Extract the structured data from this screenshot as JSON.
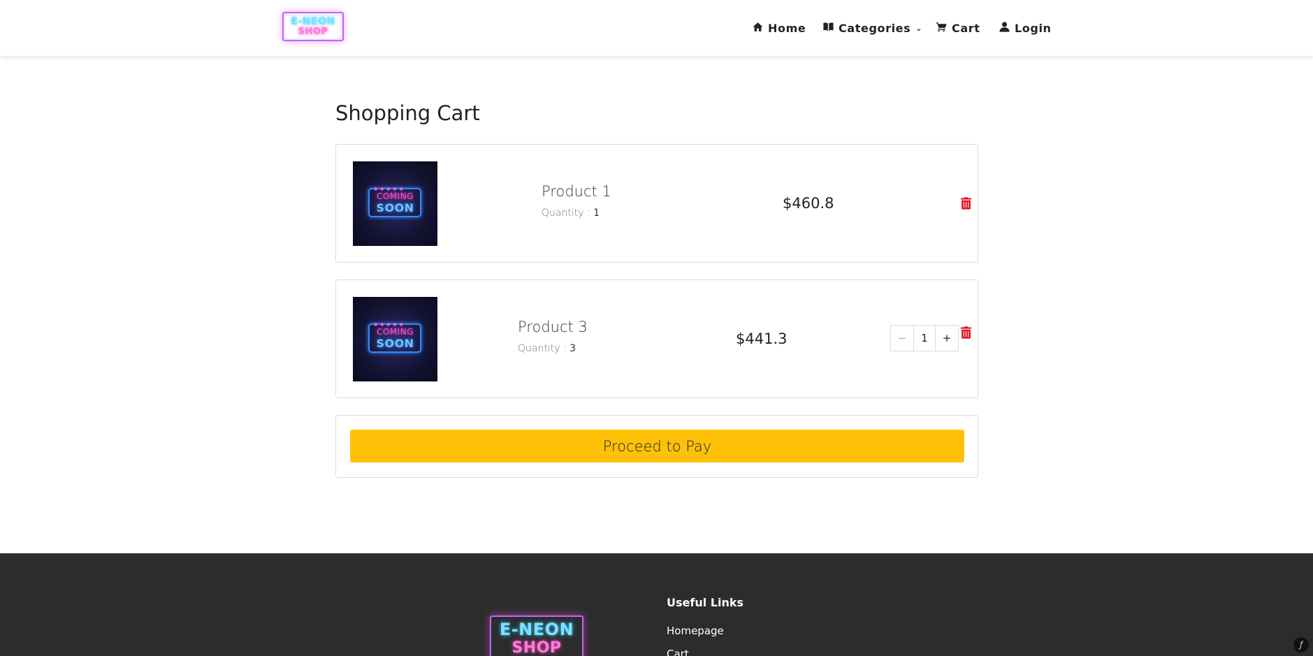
{
  "header": {
    "logo": {
      "line1": "E-NEON",
      "line2": "SHOP"
    },
    "nav": {
      "home": "Home",
      "categories": "Categories",
      "cart": "Cart",
      "login": "Login"
    }
  },
  "main": {
    "title": "Shopping Cart",
    "items": [
      {
        "image_text_top": "COMING",
        "image_text_bottom": "SOON",
        "name": "Product 1",
        "quantity_label": "Quantity :",
        "quantity": "1",
        "price": "$460.8"
      },
      {
        "image_text_top": "COMING",
        "image_text_bottom": "SOON",
        "name": "Product 3",
        "quantity_label": "Quantity :",
        "quantity": "3",
        "price": "$441.3",
        "stepper": {
          "minus": "−",
          "value": "1",
          "plus": "+"
        }
      }
    ],
    "pay_button": "Proceed to Pay"
  },
  "footer": {
    "logo": {
      "line1": "E-NEON",
      "line2": "SHOP"
    },
    "useful_links_title": "Useful Links",
    "links": [
      "Homepage",
      "Cart"
    ]
  },
  "icons": {
    "home": "home-icon",
    "categories": "book-icon",
    "cart": "cart-icon",
    "login": "user-icon",
    "remove": "trash-icon",
    "debug": "symfony-icon"
  },
  "colors": {
    "accent": "#ffc107",
    "trash": "#e3101c",
    "footer_bg": "#2c2c2c"
  }
}
